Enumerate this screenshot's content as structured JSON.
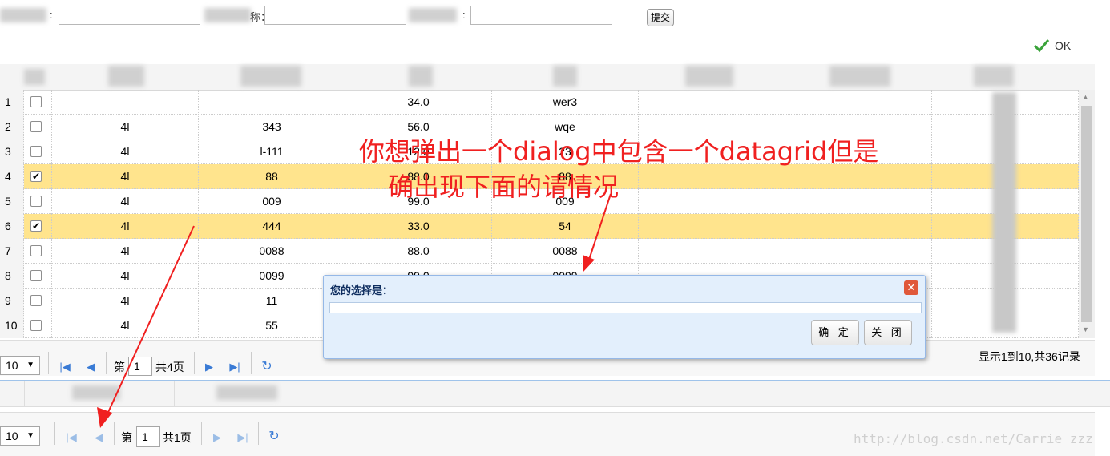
{
  "form": {
    "label1": ":",
    "label2": "称：",
    "label3": ":",
    "submit_label": "提交"
  },
  "toolbar": {
    "ok_label": "OK"
  },
  "grid": {
    "rows": [
      {
        "num": "1",
        "checked": false,
        "c1": "",
        "c2": "",
        "c3": "34.0",
        "c4": "wer3"
      },
      {
        "num": "2",
        "checked": false,
        "c1": "4l",
        "c2": "343",
        "c3": "56.0",
        "c4": "wqe"
      },
      {
        "num": "3",
        "checked": false,
        "c1": "4l",
        "c2": "l-111",
        "c3": "12.0",
        "c4": "23"
      },
      {
        "num": "4",
        "checked": true,
        "c1": "4l",
        "c2": "88",
        "c3": "88.0",
        "c4": "88"
      },
      {
        "num": "5",
        "checked": false,
        "c1": "4l",
        "c2": "009",
        "c3": "99.0",
        "c4": "009"
      },
      {
        "num": "6",
        "checked": true,
        "c1": "4l",
        "c2": "444",
        "c3": "33.0",
        "c4": "54"
      },
      {
        "num": "7",
        "checked": false,
        "c1": "4l",
        "c2": "0088",
        "c3": "88.0",
        "c4": "0088"
      },
      {
        "num": "8",
        "checked": false,
        "c1": "4l",
        "c2": "0099",
        "c3": "99.0",
        "c4": "0099"
      },
      {
        "num": "9",
        "checked": false,
        "c1": "4l",
        "c2": "11",
        "c3": "",
        "c4": ""
      },
      {
        "num": "10",
        "checked": false,
        "c1": "4l",
        "c2": "55",
        "c3": "",
        "c4": ""
      }
    ]
  },
  "pager1": {
    "page_size": "10",
    "page_prefix": "第",
    "page_value": "1",
    "page_total": "共4页",
    "display_info": "显示1到10,共36记录"
  },
  "pager2": {
    "page_size": "10",
    "page_prefix": "第",
    "page_value": "1",
    "page_total": "共1页"
  },
  "dialog": {
    "title": "您的选择是：",
    "ok_label": "确 定",
    "close_label": "关 闭"
  },
  "annotation": {
    "line1": "你想弹出一个dialog中包含一个datagrid但是",
    "line2": "确出现下面的请情况"
  },
  "watermark": "http://blog.csdn.net/Carrie_zzz",
  "icons": {
    "check": "ok-check-icon",
    "first": "first-page-icon",
    "prev": "prev-page-icon",
    "next": "next-page-icon",
    "last": "last-page-icon",
    "refresh": "refresh-icon",
    "close": "close-icon"
  },
  "colors": {
    "selected_row": "#ffe48d",
    "annotation": "#f02020",
    "dialog_bg": "#e3effc"
  }
}
